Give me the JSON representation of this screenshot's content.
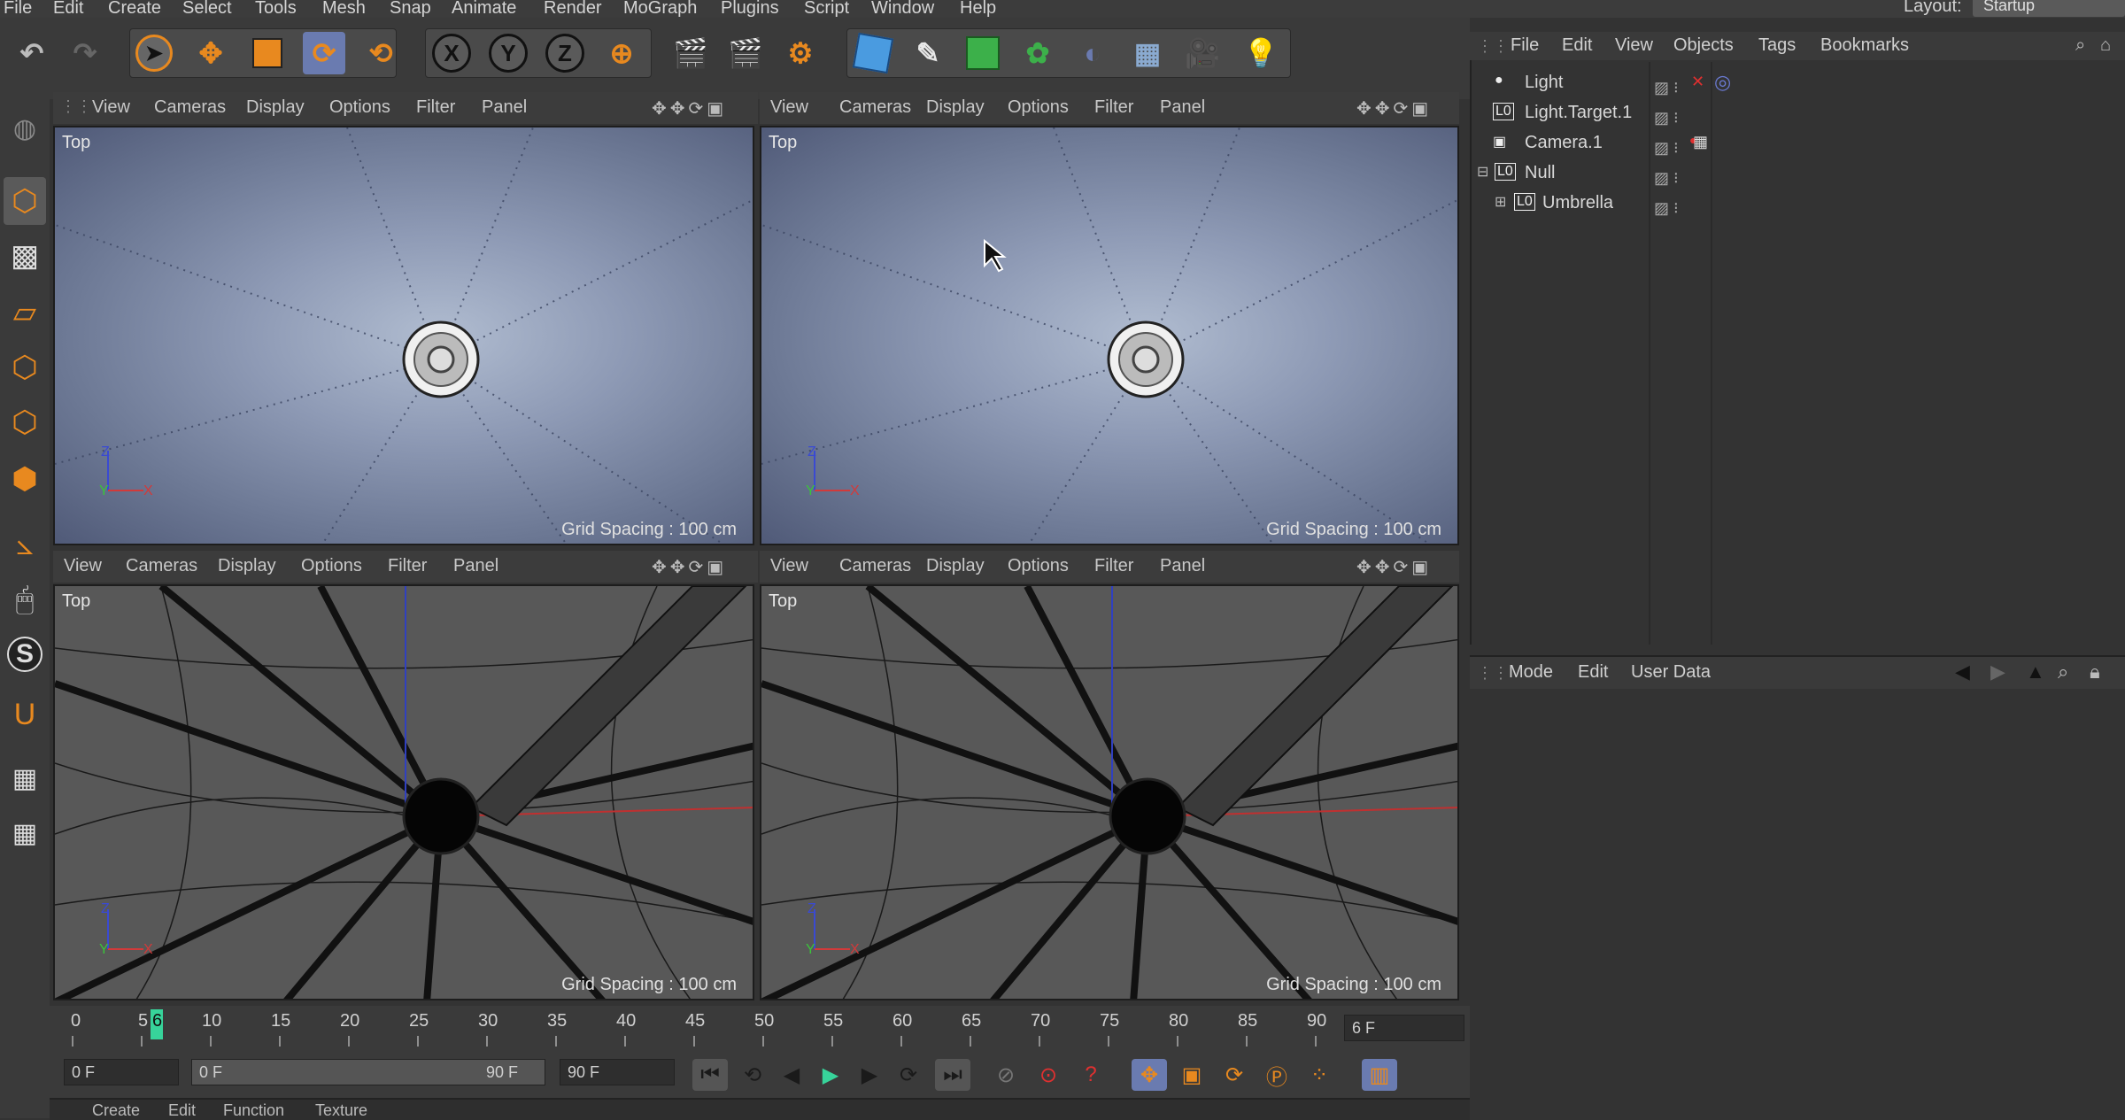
{
  "menubar": {
    "items": [
      "File",
      "Edit",
      "Create",
      "Select",
      "Tools",
      "Mesh",
      "Snap",
      "Animate",
      "Render",
      "MoGraph",
      "Plugins",
      "Script",
      "Window",
      "Help"
    ],
    "layout_label": "Layout:",
    "layout_value": "Startup"
  },
  "viewport_menu": [
    "View",
    "Cameras",
    "Display",
    "Options",
    "Filter",
    "Panel"
  ],
  "viewports": [
    {
      "label": "Top",
      "grid": "Grid Spacing : 100 cm"
    },
    {
      "label": "Top",
      "grid": "Grid Spacing : 100 cm"
    },
    {
      "label": "Top",
      "grid": "Grid Spacing : 100 cm"
    },
    {
      "label": "Top",
      "grid": "Grid Spacing : 100 cm"
    }
  ],
  "axis": {
    "z": "Z",
    "y": "Y",
    "x": "X"
  },
  "object_manager": {
    "menu": [
      "File",
      "Edit",
      "View",
      "Objects",
      "Tags",
      "Bookmarks"
    ],
    "objects": [
      {
        "name": "Light"
      },
      {
        "name": "Light.Target.1"
      },
      {
        "name": "Camera.1"
      },
      {
        "name": "Null"
      },
      {
        "name": "Umbrella"
      }
    ]
  },
  "attribute_manager": {
    "menu": [
      "Mode",
      "Edit",
      "User Data"
    ]
  },
  "timeline": {
    "ticks": [
      "0",
      "5",
      "10",
      "15",
      "20",
      "25",
      "30",
      "35",
      "40",
      "45",
      "50",
      "55",
      "60",
      "65",
      "70",
      "75",
      "80",
      "85",
      "90"
    ],
    "current_frame_marker": "6",
    "end_field": "6 F"
  },
  "transport": {
    "start_field": "0 F",
    "range_start": "0 F",
    "range_end": "90 F",
    "end_field": "90 F"
  },
  "bottom_strip": {
    "menu": [
      "Create",
      "Edit",
      "Function",
      "Texture"
    ]
  },
  "colors": {
    "accent_orange": "#e8891f",
    "timeline_marker": "#37d39a",
    "axis_red": "#d23a3a",
    "axis_green": "#3ac43a",
    "axis_blue": "#3a4ad2"
  }
}
